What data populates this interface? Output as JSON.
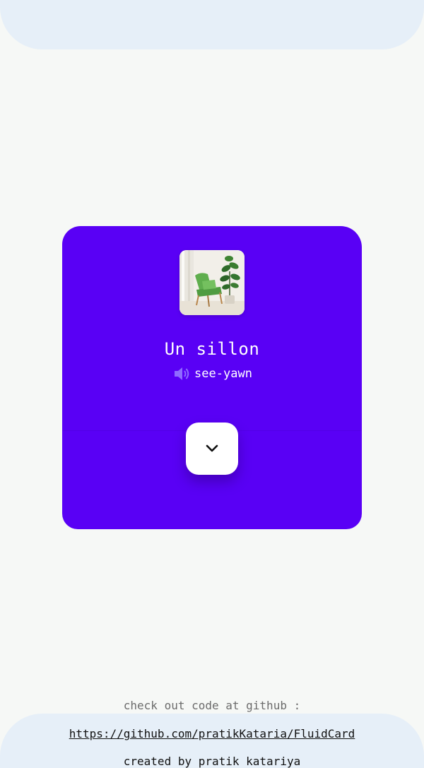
{
  "card": {
    "word": "Un sillon",
    "pronunciation": "see-yawn",
    "background_color": "#5900f5",
    "image_subject": "green armchair with potted plant",
    "expand_icon": "chevron-down-icon",
    "speaker_icon": "speaker-icon"
  },
  "footer": {
    "note": "check out code at github :",
    "link": "https://github.com/pratikKataria/FluidCard",
    "credit": "created by pratik katariya"
  }
}
